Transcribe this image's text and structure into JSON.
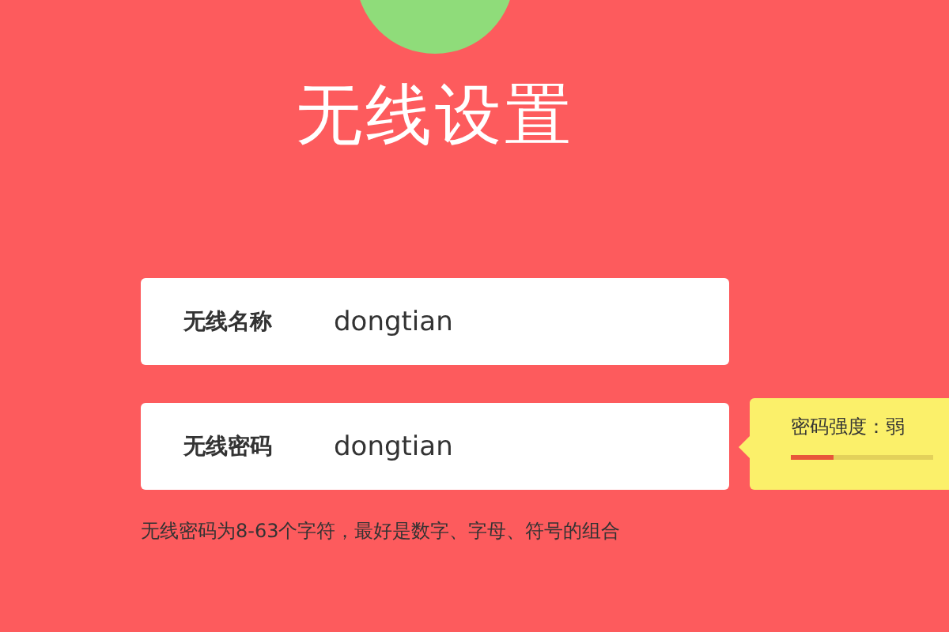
{
  "title": "无线设置",
  "fields": [
    {
      "label": "无线名称",
      "value": "dongtian"
    },
    {
      "label": "无线密码",
      "value": "dongtian"
    }
  ],
  "strength_tip": {
    "text": "密码强度：弱",
    "level": 0.3
  },
  "hint": "无线密码为8-63个字符，最好是数字、字母、符号的组合"
}
